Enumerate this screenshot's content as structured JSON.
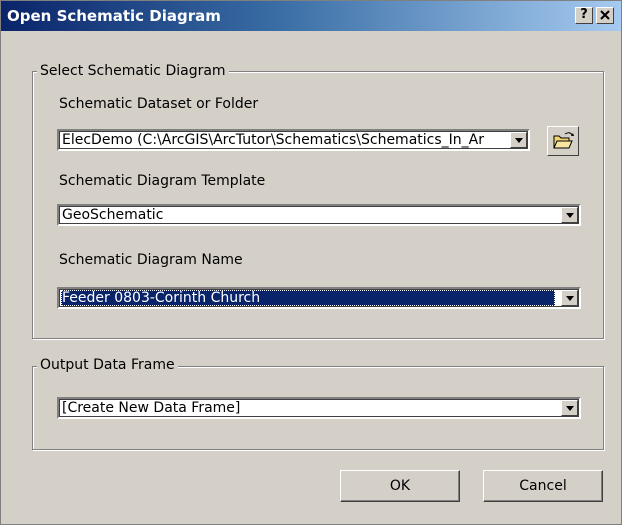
{
  "window": {
    "title": "Open Schematic Diagram",
    "help_label": "?",
    "close_label": "✕"
  },
  "select_group": {
    "legend": "Select Schematic Diagram",
    "dataset": {
      "label": "Schematic Dataset or Folder",
      "value": "ElecDemo (C:\\ArcGIS\\ArcTutor\\Schematics\\Schematics_In_Ar"
    },
    "template": {
      "label": "Schematic Diagram Template",
      "value": "GeoSchematic"
    },
    "name": {
      "label": "Schematic Diagram Name",
      "value": "Feeder 0803-Corinth Church"
    }
  },
  "output_group": {
    "legend": "Output Data Frame",
    "value": "[Create New Data Frame]"
  },
  "buttons": {
    "ok": "OK",
    "cancel": "Cancel"
  },
  "colors": {
    "title_bar_start": "#0a246a",
    "title_bar_end": "#a6caf0",
    "dialog_face": "#d4d0c8",
    "selection": "#0a246a",
    "folder_icon": "#f2d472"
  },
  "icons": {
    "browse": "open-folder-icon",
    "dropdown": "chevron-down-icon"
  }
}
